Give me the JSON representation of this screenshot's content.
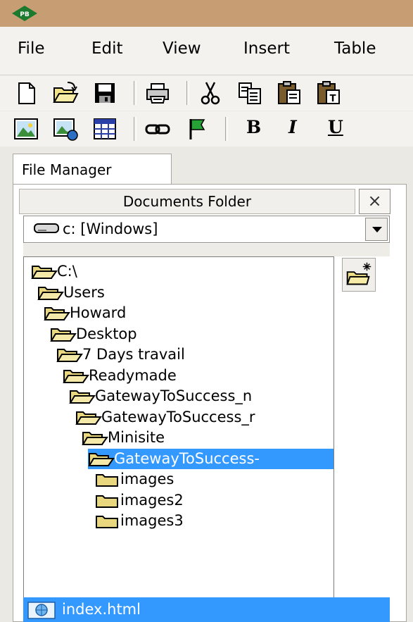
{
  "menu": {
    "items": [
      "File",
      "Edit",
      "View",
      "Insert",
      "Table"
    ]
  },
  "toolbar_row1": [
    "new-file",
    "open-folder",
    "save",
    "print",
    "cut",
    "copy",
    "paste",
    "paste-special"
  ],
  "toolbar_row2": [
    "insert-image",
    "insert-image-link",
    "insert-table",
    "link",
    "anchor-flag"
  ],
  "format": {
    "bold": "B",
    "italic": "I",
    "underline": "U"
  },
  "file_manager": {
    "tab_label": "File Manager",
    "header": "Documents Folder",
    "close_symbol": "×",
    "drive": "c: [Windows]",
    "tree": [
      {
        "label": "C:\\",
        "depth": 0
      },
      {
        "label": "Users",
        "depth": 1
      },
      {
        "label": "Howard",
        "depth": 2
      },
      {
        "label": "Desktop",
        "depth": 3
      },
      {
        "label": "7 Days travail",
        "depth": 4
      },
      {
        "label": "Readymade",
        "depth": 5
      },
      {
        "label": "GatewayToSuccess_n",
        "depth": 6
      },
      {
        "label": "GatewayToSuccess_r",
        "depth": 7
      },
      {
        "label": "Minisite",
        "depth": 8
      },
      {
        "label": "GatewayToSuccess-",
        "depth": 9,
        "selected": true
      },
      {
        "label": "images",
        "depth": 10,
        "closed": true
      },
      {
        "label": "images2",
        "depth": 10,
        "closed": true
      },
      {
        "label": "images3",
        "depth": 10,
        "closed": true
      }
    ],
    "files": [
      {
        "label": "index.html",
        "selected": true
      }
    ]
  },
  "colors": {
    "titlebar": "#c79e74",
    "selection": "#3399ff",
    "folder": "#e8d77f"
  }
}
